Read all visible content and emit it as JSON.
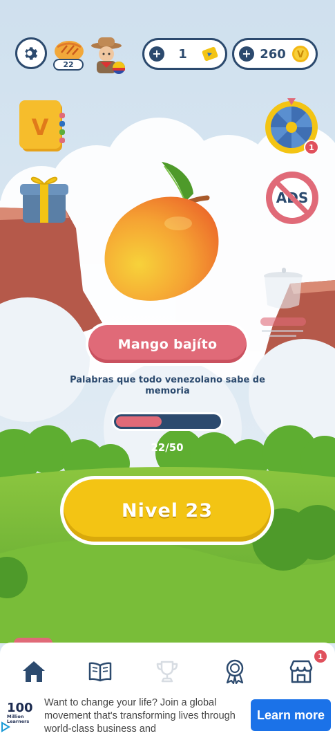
{
  "top_bar": {
    "settings_icon": "gear-icon",
    "level_badge": "22",
    "keys_count": "1",
    "coins_count": "260",
    "coin_symbol": "V"
  },
  "side_items": {
    "book_letter": "V",
    "wheel_badge": "1",
    "no_ads_label": "ADS"
  },
  "main": {
    "category_label": "Mango bajíto",
    "subtitle": "Palabras que todo venezolano sabe de memoria",
    "progress_text": "22/50",
    "progress_value": 0.44,
    "level_button_label": "Nivel 23"
  },
  "bottom_nav": {
    "items": [
      {
        "name": "home",
        "icon": "home-icon"
      },
      {
        "name": "book",
        "icon": "book-icon"
      },
      {
        "name": "trophy",
        "icon": "trophy-icon"
      },
      {
        "name": "medal",
        "icon": "medal-icon"
      },
      {
        "name": "shop",
        "icon": "shop-icon"
      }
    ],
    "shop_badge": "1"
  },
  "ad": {
    "logo_number": "100",
    "logo_text": "Million Learners",
    "text": "Want to change your life? Join a global movement that's transforming lives through world-class business and",
    "cta": "Learn more"
  },
  "colors": {
    "navy": "#2c4a6e",
    "pink": "#e06a78",
    "yellow": "#f3c414",
    "green": "#6fb83a",
    "cta_blue": "#1b72e8"
  }
}
